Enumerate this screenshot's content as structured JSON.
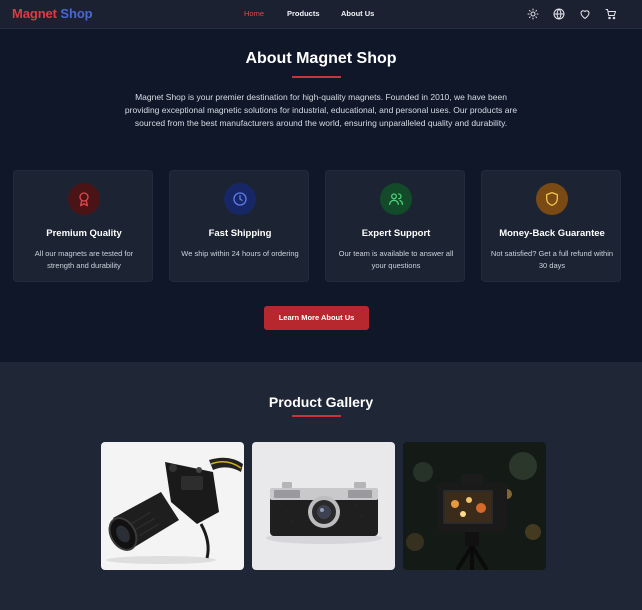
{
  "nav": {
    "brand_part1": "Magnet",
    "brand_part2": "Shop",
    "links": [
      {
        "label": "Home",
        "active": true
      },
      {
        "label": "Products",
        "active": false
      },
      {
        "label": "About Us",
        "active": false
      }
    ],
    "icons": [
      "sun-icon",
      "globe-icon",
      "heart-icon",
      "cart-icon"
    ]
  },
  "about": {
    "title": "About Magnet Shop",
    "description": "Magnet Shop is your premier destination for high-quality magnets. Founded in 2010, we have been providing exceptional magnetic solutions for industrial, educational, and personal uses. Our products are sourced from the best manufacturers around the world, ensuring unparalleled quality and durability.",
    "features": [
      {
        "title": "Premium Quality",
        "text": "All our magnets are tested for strength and durability",
        "icon": "award-icon",
        "color": "#e0474c"
      },
      {
        "title": "Fast Shipping",
        "text": "We ship within 24 hours of ordering",
        "icon": "clock-icon",
        "color": "#5470e0"
      },
      {
        "title": "Expert Support",
        "text": "Our team is available to answer all your questions",
        "icon": "users-icon",
        "color": "#3fbf66"
      },
      {
        "title": "Money-Back Guarantee",
        "text": "Not satisfied? Get a full refund within 30 days",
        "icon": "shield-icon",
        "color": "#e3b23c"
      }
    ],
    "cta_label": "Learn More About Us"
  },
  "gallery": {
    "title": "Product Gallery",
    "photos": [
      "dslr-camera-photo",
      "vintage-rangefinder-camera-photo",
      "camera-on-tripod-night-photo"
    ]
  },
  "colors": {
    "accent_red": "#b7282e",
    "brand_red": "#dc3c42",
    "brand_blue": "#4a67d6",
    "background": "#0f1729",
    "card": "#1c2433"
  }
}
